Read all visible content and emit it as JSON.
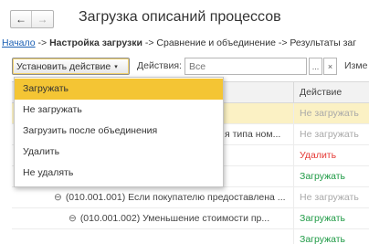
{
  "window": {
    "title": "Загрузка описаний процессов",
    "back_icon": "←",
    "forward_icon": "→"
  },
  "breadcrumb": {
    "link": "Начало",
    "sep1": " -> ",
    "current": "Настройка загрузки",
    "rest": " -> Сравнение и объединение -> Результаты заг"
  },
  "toolbar": {
    "action_button": "Установить действие",
    "caret": "▾",
    "actions_label": "Действия:",
    "actions_placeholder": "Все",
    "select_button": "...",
    "clear_button": "×",
    "truncated_label": "Изме"
  },
  "menu": {
    "items": [
      {
        "label": "Загружать",
        "active": true
      },
      {
        "label": "Не загружать",
        "active": false
      },
      {
        "label": "Загрузить после объединения",
        "active": false
      },
      {
        "label": "Удалить",
        "active": false
      },
      {
        "label": "Не удалять",
        "active": false
      }
    ]
  },
  "table": {
    "columns": {
      "action": "Действие"
    },
    "rows": [
      {
        "name": "",
        "action": "Не загружать",
        "status": "gray"
      },
      {
        "name": "я типа ном...",
        "action": "Не загружать",
        "status": "gray"
      },
      {
        "name": "",
        "action": "Удалить",
        "status": "red"
      },
      {
        "name": "",
        "action": "Загружать",
        "status": "green"
      },
      {
        "name": "(010.001.001) Если покупателю предоставлена ...",
        "expand": "⊖",
        "action": "Не загружать",
        "status": "gray"
      },
      {
        "name": "(010.001.002) Уменьшение стоимости пр...",
        "expand": "⊖",
        "action": "Загружать",
        "status": "green"
      },
      {
        "name": "",
        "action": "Загружать",
        "status": "green"
      }
    ]
  },
  "colors": {
    "accent": "#f4c534",
    "highlight_row": "#fbf1c4",
    "link": "#1a5fb4",
    "status_green": "#1e9a45",
    "status_red": "#e53935",
    "status_gray": "#a9a9a9"
  }
}
